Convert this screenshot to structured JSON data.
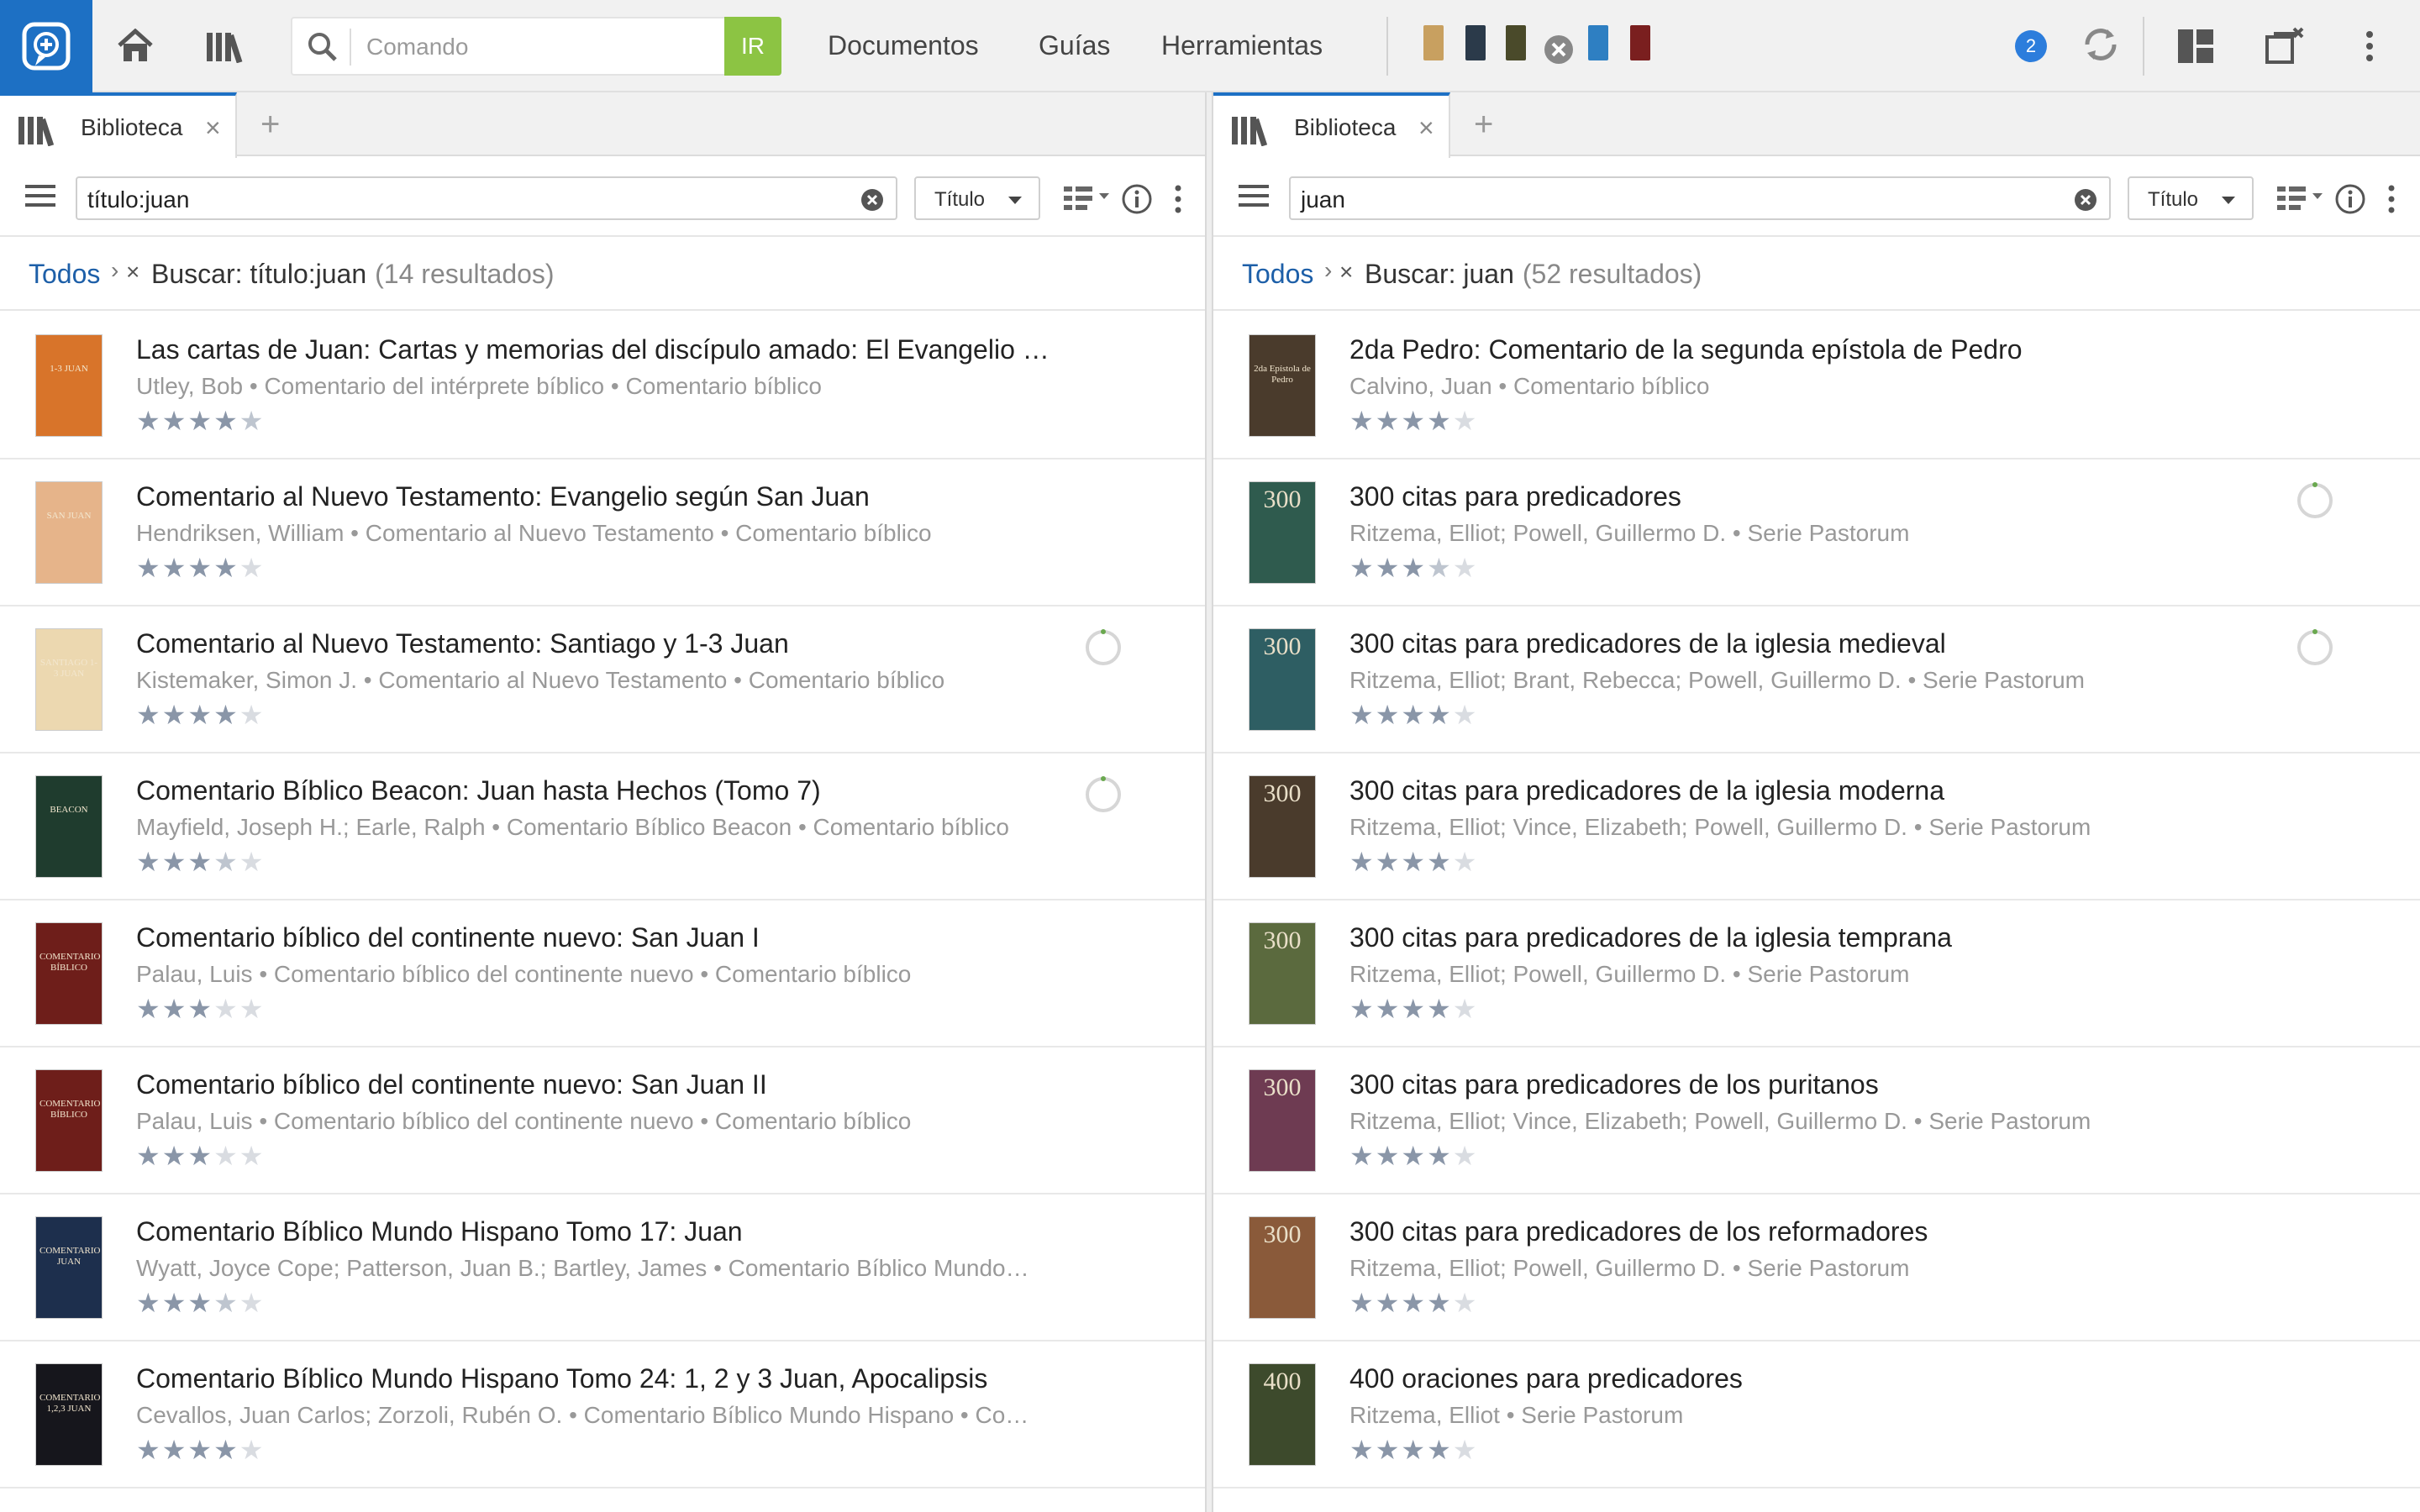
{
  "topbar": {
    "search_placeholder": "Comando",
    "go_label": "IR",
    "menus": [
      "Documentos",
      "Guías",
      "Herramientas"
    ],
    "notification_count": "2"
  },
  "left": {
    "tab_label": "Biblioteca",
    "filter_text": "título:juan",
    "sort_label": "Título",
    "crumb_all": "Todos",
    "crumb_query": "Buscar: título:juan",
    "crumb_count": "(14 resultados)",
    "rows": [
      {
        "title": "Las cartas de Juan: Cartas y memorias del discípulo amado: El Evangelio y P…",
        "meta": "Utley, Bob • Comentario del intérprete bíblico • Comentario bíblico",
        "stars": "4.5",
        "cover": "#d8742a",
        "cover_text": "1-3 JUAN"
      },
      {
        "title": "Comentario al Nuevo Testamento: Evangelio según San Juan",
        "meta": "Hendriksen, William • Comentario al Nuevo Testamento • Comentario bíblico",
        "stars": "4",
        "cover": "#e6b48a",
        "cover_text": "SAN JUAN"
      },
      {
        "title": "Comentario al Nuevo Testamento: Santiago y 1-3 Juan",
        "meta": "Kistemaker, Simon J. • Comentario al Nuevo Testamento • Comentario bíblico",
        "stars": "4",
        "cover": "#ecd8b0",
        "cover_text": "SANTIAGO 1-3 JUAN"
      },
      {
        "title": "Comentario Bíblico Beacon: Juan hasta Hechos (Tomo 7)",
        "meta": "Mayfield, Joseph H.; Earle, Ralph • Comentario Bíblico Beacon • Comentario bíblico",
        "stars": "3.5",
        "cover": "#1f3c2e",
        "cover_text": "BEACON"
      },
      {
        "title": "Comentario bíblico del continente nuevo: San Juan I",
        "meta": "Palau, Luis • Comentario bíblico del continente nuevo • Comentario bíblico",
        "stars": "3",
        "cover": "#6e1e1a",
        "cover_text": "COMENTARIO BÍBLICO"
      },
      {
        "title": "Comentario bíblico del continente nuevo: San Juan II",
        "meta": "Palau, Luis • Comentario bíblico del continente nuevo • Comentario bíblico",
        "stars": "3",
        "cover": "#6e1e1a",
        "cover_text": "COMENTARIO BÍBLICO"
      },
      {
        "title": "Comentario Bíblico Mundo Hispano Tomo 17: Juan",
        "meta": "Wyatt, Joyce Cope; Patterson, Juan B.; Bartley, James • Comentario Bíblico Mundo…",
        "stars": "3.5",
        "cover": "#1d2f4d",
        "cover_text": "COMENTARIO JUAN"
      },
      {
        "title": "Comentario Bíblico Mundo Hispano Tomo 24: 1, 2 y 3 Juan, Apocalipsis",
        "meta": "Cevallos, Juan Carlos; Zorzoli, Rubén O. • Comentario Bíblico Mundo Hispano • Co…",
        "stars": "4",
        "cover": "#16161c",
        "cover_text": "COMENTARIO 1,2,3 JUAN"
      }
    ]
  },
  "right": {
    "tab_label": "Biblioteca",
    "filter_text": "juan",
    "sort_label": "Título",
    "crumb_all": "Todos",
    "crumb_query": "Buscar: juan",
    "crumb_count": "(52 resultados)",
    "rows": [
      {
        "title": "2da Pedro: Comentario de la segunda epístola de Pedro",
        "meta": "Calvino, Juan • Comentario bíblico",
        "stars": "4",
        "cover": "#4a3b2c",
        "cover_text": "2da Epístola de Pedro"
      },
      {
        "title": "300 citas para predicadores",
        "meta": "Ritzema, Elliot; Powell, Guillermo D. • Serie Pastorum",
        "stars": "3.5",
        "cover": "#2f5b4e",
        "cover_text": "300"
      },
      {
        "title": "300 citas para predicadores de la iglesia medieval",
        "meta": "Ritzema, Elliot; Brant, Rebecca; Powell, Guillermo D. • Serie Pastorum",
        "stars": "4",
        "cover": "#2e5e63",
        "cover_text": "300"
      },
      {
        "title": "300 citas para predicadores de la iglesia moderna",
        "meta": "Ritzema, Elliot; Vince, Elizabeth; Powell, Guillermo D. • Serie Pastorum",
        "stars": "4",
        "cover": "#4a3b2c",
        "cover_text": "300"
      },
      {
        "title": "300 citas para predicadores de la iglesia temprana",
        "meta": "Ritzema, Elliot; Powell, Guillermo D. • Serie Pastorum",
        "stars": "4",
        "cover": "#5b6a3e",
        "cover_text": "300"
      },
      {
        "title": "300 citas para predicadores de los puritanos",
        "meta": "Ritzema, Elliot; Vince, Elizabeth; Powell, Guillermo D. • Serie Pastorum",
        "stars": "4",
        "cover": "#6e3b52",
        "cover_text": "300"
      },
      {
        "title": "300 citas para predicadores de los reformadores",
        "meta": "Ritzema, Elliot; Powell, Guillermo D. • Serie Pastorum",
        "stars": "4",
        "cover": "#8a5a3a",
        "cover_text": "300"
      },
      {
        "title": "400 oraciones para predicadores",
        "meta": "Ritzema, Elliot • Serie Pastorum",
        "stars": "4",
        "cover": "#3d4a2c",
        "cover_text": "400"
      }
    ]
  }
}
